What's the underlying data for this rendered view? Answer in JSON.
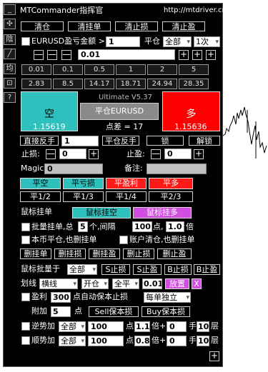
{
  "header": {
    "title": "MTCommander指挥官",
    "url": "http://mtdriver.cn"
  },
  "side_icons": [
    "_",
    "✣",
    "陰",
    "╱",
    "均",
    "⊡",
    "?"
  ],
  "row1": [
    "清仓",
    "清挂单",
    "清止损",
    "清止盈"
  ],
  "amount": {
    "label": "EURUSD盈亏金额 >",
    "value": "1",
    "pc_label": "平仓",
    "pc_select": "全部",
    "times_select": "1次"
  },
  "lot": {
    "minus": "—",
    "value": "0.01",
    "plus": "+"
  },
  "presets1": [
    "0.01",
    "0.1",
    "0.5",
    "1",
    "2",
    "5"
  ],
  "presets2": [
    "2.83",
    "8.5",
    "14.17",
    "18.71",
    "24.94",
    "28.35"
  ],
  "version": "Ultimate V5.37",
  "sell": {
    "label": "空",
    "price": "1.15619"
  },
  "close_symbol": "平仓EURUSD",
  "spread": "点差 = 17",
  "buy": {
    "label": "多",
    "price": "1.15636"
  },
  "reverse": {
    "direct": "直接反手",
    "value": "1",
    "close_reverse": "平仓反手",
    "lock": "锁",
    "unlock": "解锁"
  },
  "sl": {
    "label": "止损:",
    "value": "0"
  },
  "tp": {
    "label": "止盈:",
    "value": "0"
  },
  "magic": {
    "label": "Magic:",
    "value": "0"
  },
  "note": {
    "label": "备注:",
    "value": ""
  },
  "close_row": [
    "平空",
    "平亏损",
    "平盈利",
    "平多"
  ],
  "partial_row": [
    "平1/2",
    "平1/3",
    "平1/4",
    "平2/3"
  ],
  "mouse": {
    "label": "鼠标挂单",
    "short": "鼠标挂空",
    "long": "鼠标挂多"
  },
  "batch": {
    "label": "批量挂单,总",
    "count": "5",
    "unit1": "个,间隔",
    "gap": "100",
    "unit2": "点,",
    "mult": "1.0",
    "unit3": "倍"
  },
  "opt1": "本币平仓,也删挂单",
  "opt2": "账户清仓,也删挂单",
  "del_row": [
    "删挂单",
    "删挂损",
    "删挂盈",
    "删止损",
    "删止盈"
  ],
  "mouse_batch": {
    "label": "鼠标批量于",
    "select": "全部",
    "btns": [
      "S止损",
      "S止盈",
      "B止损",
      "B止盈"
    ]
  },
  "draw": {
    "label": "划线",
    "type": "横线",
    "action": "开仓",
    "dir": "全平",
    "value": "0.01",
    "place": "放置",
    "close": "X"
  },
  "profit": {
    "label_pre": "盈利",
    "value": "300",
    "label_post": "点自动保本止损",
    "select": "每单独立"
  },
  "extra": {
    "label": "附加",
    "value": "5",
    "unit": "点",
    "sell_be": "Sell保本损",
    "buy_be": "Buy保本损"
  },
  "counter": {
    "label": "逆势加",
    "select": "全部",
    "pts": "100",
    "pt": "点",
    "mult": "1.1",
    "bei": "倍+",
    "add": "0",
    "hand": "手",
    "layers": "10",
    "ceng": "层"
  },
  "trend": {
    "label": "顺势加",
    "select": "全部",
    "pts": "100",
    "pt": "点",
    "mult": "0.8",
    "bei": "倍+",
    "add": "0",
    "hand": "手",
    "layers": "10",
    "ceng": "层"
  },
  "bottom_plus": "+"
}
